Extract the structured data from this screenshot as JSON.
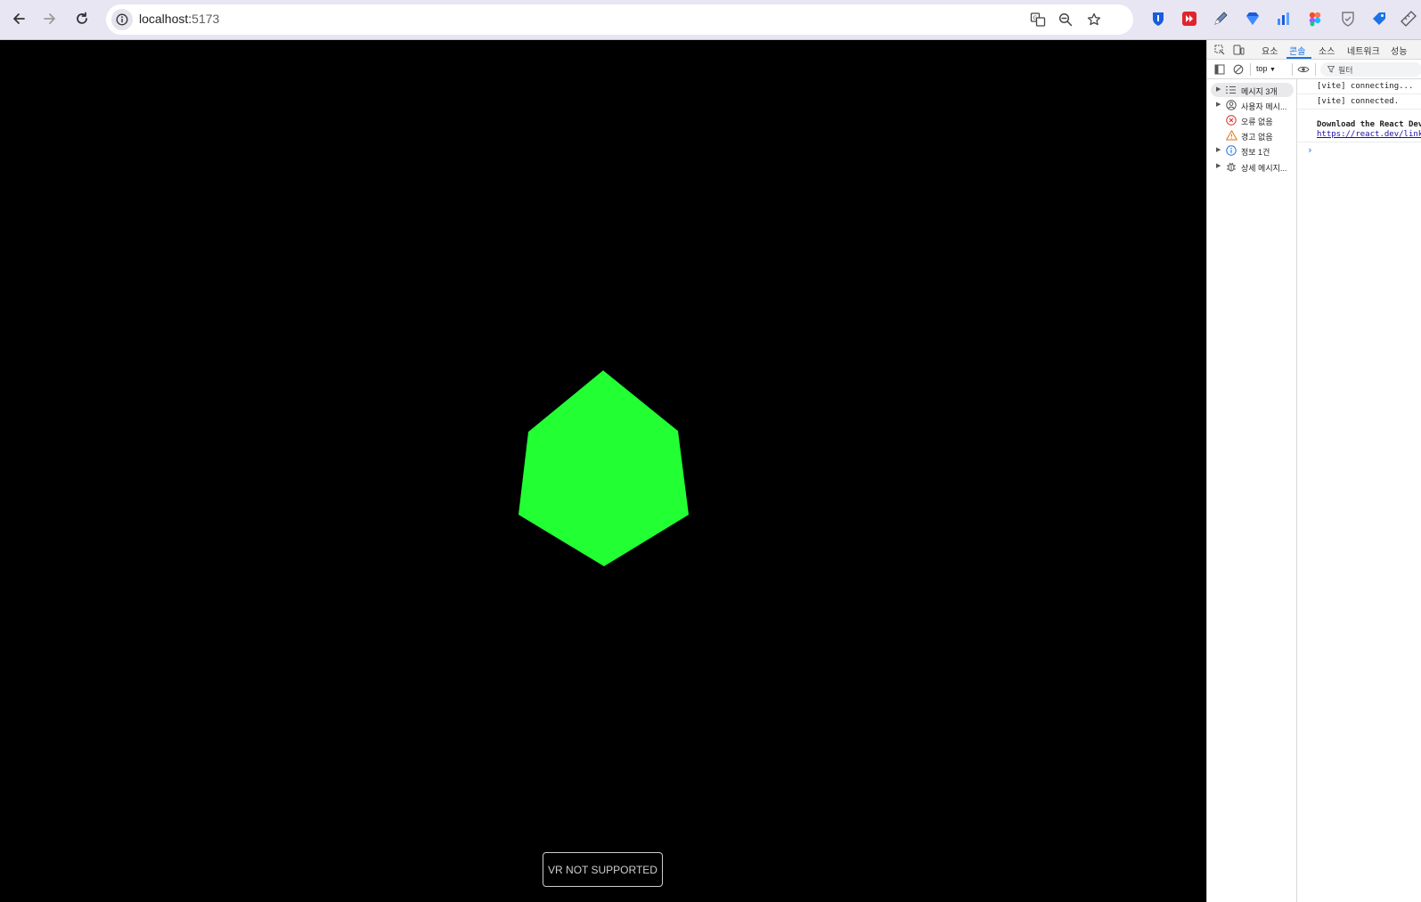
{
  "browser": {
    "url_host": "localhost:",
    "url_port": "5173"
  },
  "page": {
    "vr_button_label": "VR NOT SUPPORTED",
    "shape_color": "#22ff33"
  },
  "devtools": {
    "tabs": [
      {
        "label": "요소"
      },
      {
        "label": "콘솔"
      },
      {
        "label": "소스"
      },
      {
        "label": "네트워크"
      },
      {
        "label": "성능"
      }
    ],
    "context_selector": "top",
    "filter_placeholder": "필터",
    "sidebar": [
      {
        "label": "메시지 3개",
        "icon": "list-icon"
      },
      {
        "label": "사용자 메시...",
        "icon": "user-icon"
      },
      {
        "label": "오류 없음",
        "icon": "error-icon"
      },
      {
        "label": "경고 없음",
        "icon": "warning-icon"
      },
      {
        "label": "정보 1건",
        "icon": "info-icon"
      },
      {
        "label": "상세 메시지...",
        "icon": "bug-icon"
      }
    ],
    "console_lines": [
      {
        "text": "[vite] connecting..."
      },
      {
        "text": "[vite] connected."
      }
    ],
    "react_message": "Download the React Dev",
    "react_link": "https://react.dev/link",
    "prompt_symbol": "›"
  },
  "colors": {
    "accent": "#1a73e8",
    "error": "#d93025",
    "warning": "#e8710a",
    "info": "#1a73e8"
  }
}
